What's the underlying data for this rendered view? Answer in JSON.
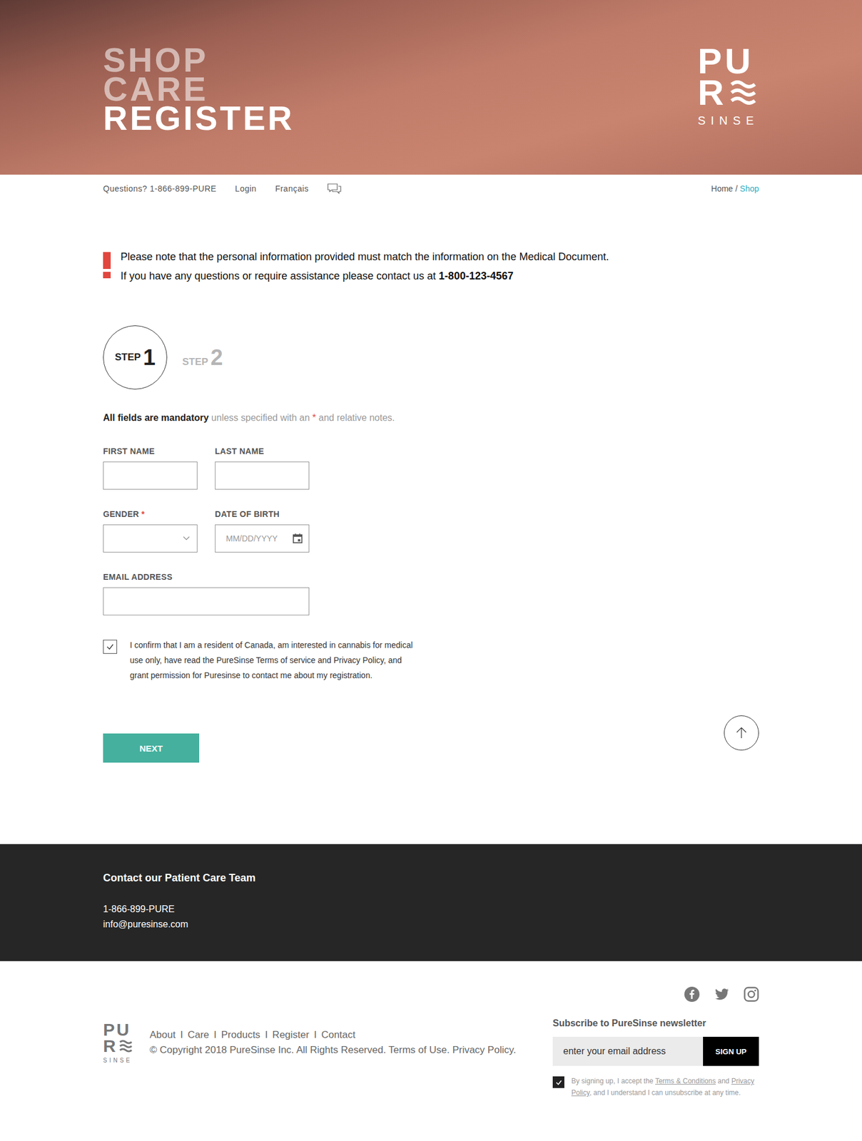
{
  "hero": {
    "menu": [
      {
        "label": "SHOP",
        "selected": false
      },
      {
        "label": "CARE",
        "selected": false
      },
      {
        "label": "REGISTER",
        "selected": true
      }
    ],
    "logo": {
      "top": "PU",
      "middle": "R",
      "tagline": "SINSE"
    }
  },
  "nav": {
    "phone": "Questions? 1-866-899-PURE",
    "links": [
      "Login",
      "Français"
    ],
    "breadcrumb": [
      {
        "label": "Home",
        "selected": false
      },
      {
        "label": "Shop",
        "selected": true
      }
    ],
    "separator": "/"
  },
  "notice": {
    "line1": "Please note that the personal information provided must match the information on the Medical Document.",
    "line2": "If you have any questions or require assistance please contact us at",
    "phone": "1-800-123-4567"
  },
  "steps": [
    {
      "label": "STEP",
      "number": "1",
      "selected": true
    },
    {
      "label": "STEP",
      "number": "2",
      "selected": false
    }
  ],
  "note": {
    "bold": "All fields are mandatory",
    "text": "unless specified with an",
    "mark": "*",
    "tail": "and relative notes."
  },
  "rows": [
    [
      {
        "label": "FIRST NAME",
        "mark": "",
        "kind": "text",
        "value": "",
        "placeholder": ""
      },
      {
        "label": "LAST NAME",
        "mark": "",
        "kind": "text",
        "value": "",
        "placeholder": ""
      }
    ],
    [
      {
        "label": "GENDER",
        "mark": "*",
        "kind": "select",
        "value": "",
        "placeholder": ""
      },
      {
        "label": "DATE OF BIRTH",
        "mark": "",
        "kind": "date",
        "value": "",
        "placeholder": "MM/DD/YYYY"
      }
    ],
    [
      {
        "label": "EMAIL ADDRESS",
        "mark": "",
        "kind": "email",
        "value": "",
        "placeholder": ""
      }
    ]
  ],
  "consent": {
    "checked": true,
    "text": "I confirm that I am a resident of Canada, am interested in cannabis for medical use only, have read the PureSinse Terms of service and Privacy Policy, and grant permission for Puresinse to contact me about my registration."
  },
  "next": "NEXT",
  "contact": {
    "title": "Contact our Patient Care Team",
    "phone": "1-866-899-PURE",
    "email": "info@puresinse.com"
  },
  "footer": {
    "logo": {
      "top": "PU",
      "middle": "R",
      "tagline": "SINSE"
    },
    "links": [
      "About",
      "Care",
      "Products",
      "Register",
      "Contact"
    ],
    "separator": "I",
    "copyright": "© Copyright 2018 PureSinse Inc. All Rights Reserved. Terms of Use. Privacy Policy.",
    "newsletter": {
      "title": "Subscribe to PureSinse newsletter",
      "placeholder": "enter your email address",
      "button": "SIGN UP",
      "checked": true,
      "consent": [
        {
          "text": "By signing up, I accept the ",
          "link": false
        },
        {
          "text": "Terms & Conditions",
          "link": true
        },
        {
          "text": " and ",
          "link": false
        },
        {
          "text": "Privacy Policy",
          "link": true
        },
        {
          "text": ", and I understand I can unsubscribe at any time.",
          "link": false
        }
      ]
    }
  }
}
